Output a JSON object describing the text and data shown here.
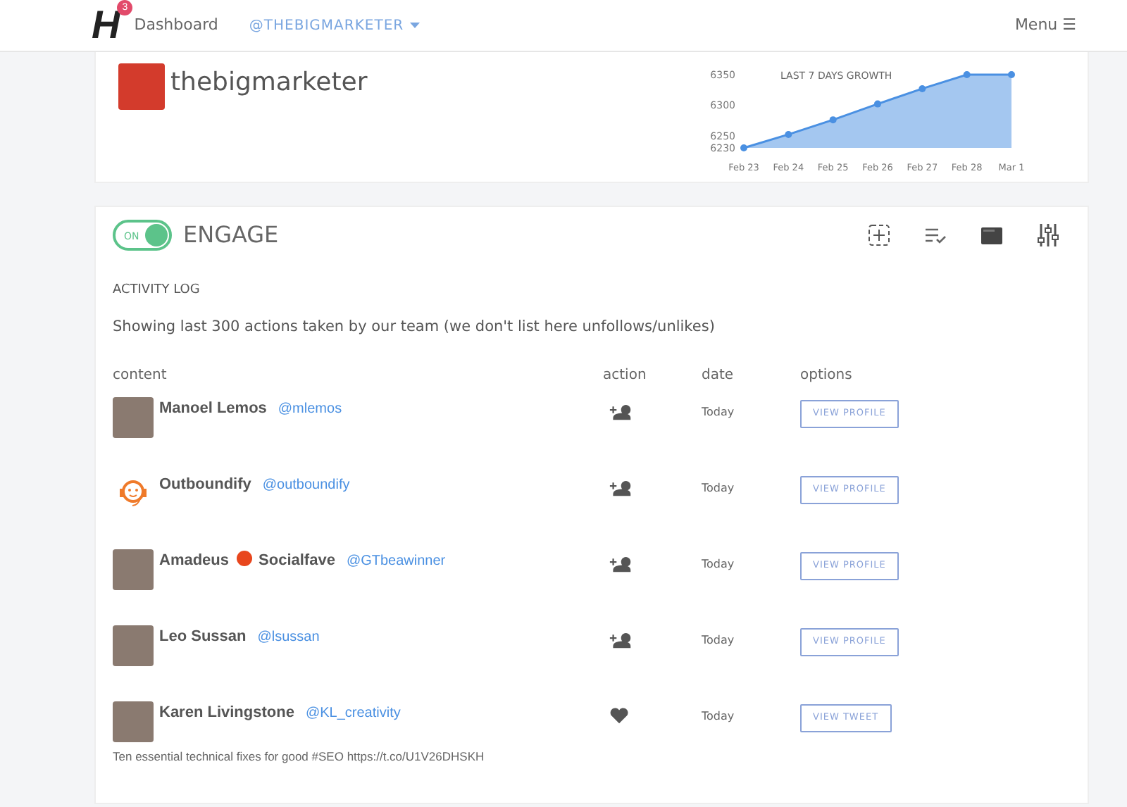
{
  "navbar": {
    "logo": "H",
    "badge": "3",
    "dashboard": "Dashboard",
    "account": "@THEBIGMARKETER",
    "menu": "Menu ☰"
  },
  "profile": {
    "username": "thebigmarketer"
  },
  "growth_chart": {
    "chart_data": {
      "type": "area",
      "title": "LAST 7 DAYS GROWTH",
      "categories": [
        "Feb 23",
        "Feb 24",
        "Feb 25",
        "Feb 26",
        "Feb 27",
        "Feb 28",
        "Mar 1"
      ],
      "series": [
        {
          "color": "#4a90e2",
          "values": [
            6230,
            6252,
            6276,
            6302,
            6327,
            6350,
            6350
          ]
        }
      ],
      "ylim": [
        6230,
        6350
      ],
      "yticks": [
        6230,
        6250,
        6300,
        6350
      ]
    }
  },
  "engage": {
    "toggle_label": "ON",
    "on": true,
    "title": "ENGAGE",
    "section": "ACTIVITY LOG",
    "description": "Showing last 300 actions taken by our team (we don't list here unfollows/unlikes)",
    "columns": [
      "content",
      "action",
      "date",
      "options"
    ],
    "rows": [
      {
        "avatar": {
          "kind": "photo"
        },
        "name": "Manoel Lemos",
        "handle": "@mlemos",
        "action": {
          "kind": "follow"
        },
        "date": "Today",
        "button": "VIEW PROFILE"
      },
      {
        "avatar": {
          "kind": "logo"
        },
        "name": "Outboundify",
        "handle": "@outboundify",
        "action": {
          "kind": "follow"
        },
        "date": "Today",
        "button": "VIEW PROFILE"
      },
      {
        "avatar": {
          "kind": "photo"
        },
        "name": "Amadeus",
        "emoji_dot": true,
        "name_suffix": "Socialfave",
        "handle": "@GTbeawinner",
        "action": {
          "kind": "follow"
        },
        "date": "Today",
        "button": "VIEW PROFILE"
      },
      {
        "avatar": {
          "kind": "photo"
        },
        "name": "Leo Sussan",
        "handle": "@lsussan",
        "action": {
          "kind": "follow"
        },
        "date": "Today",
        "button": "VIEW PROFILE"
      },
      {
        "avatar": {
          "kind": "photo"
        },
        "name": "Karen Livingstone",
        "handle": "@KL_creativity",
        "action": {
          "kind": "like"
        },
        "date": "Today",
        "button": "VIEW TWEET",
        "tweet": "Ten essential technical fixes for good #SEO https://t.co/U1V26DHSKH"
      }
    ]
  }
}
